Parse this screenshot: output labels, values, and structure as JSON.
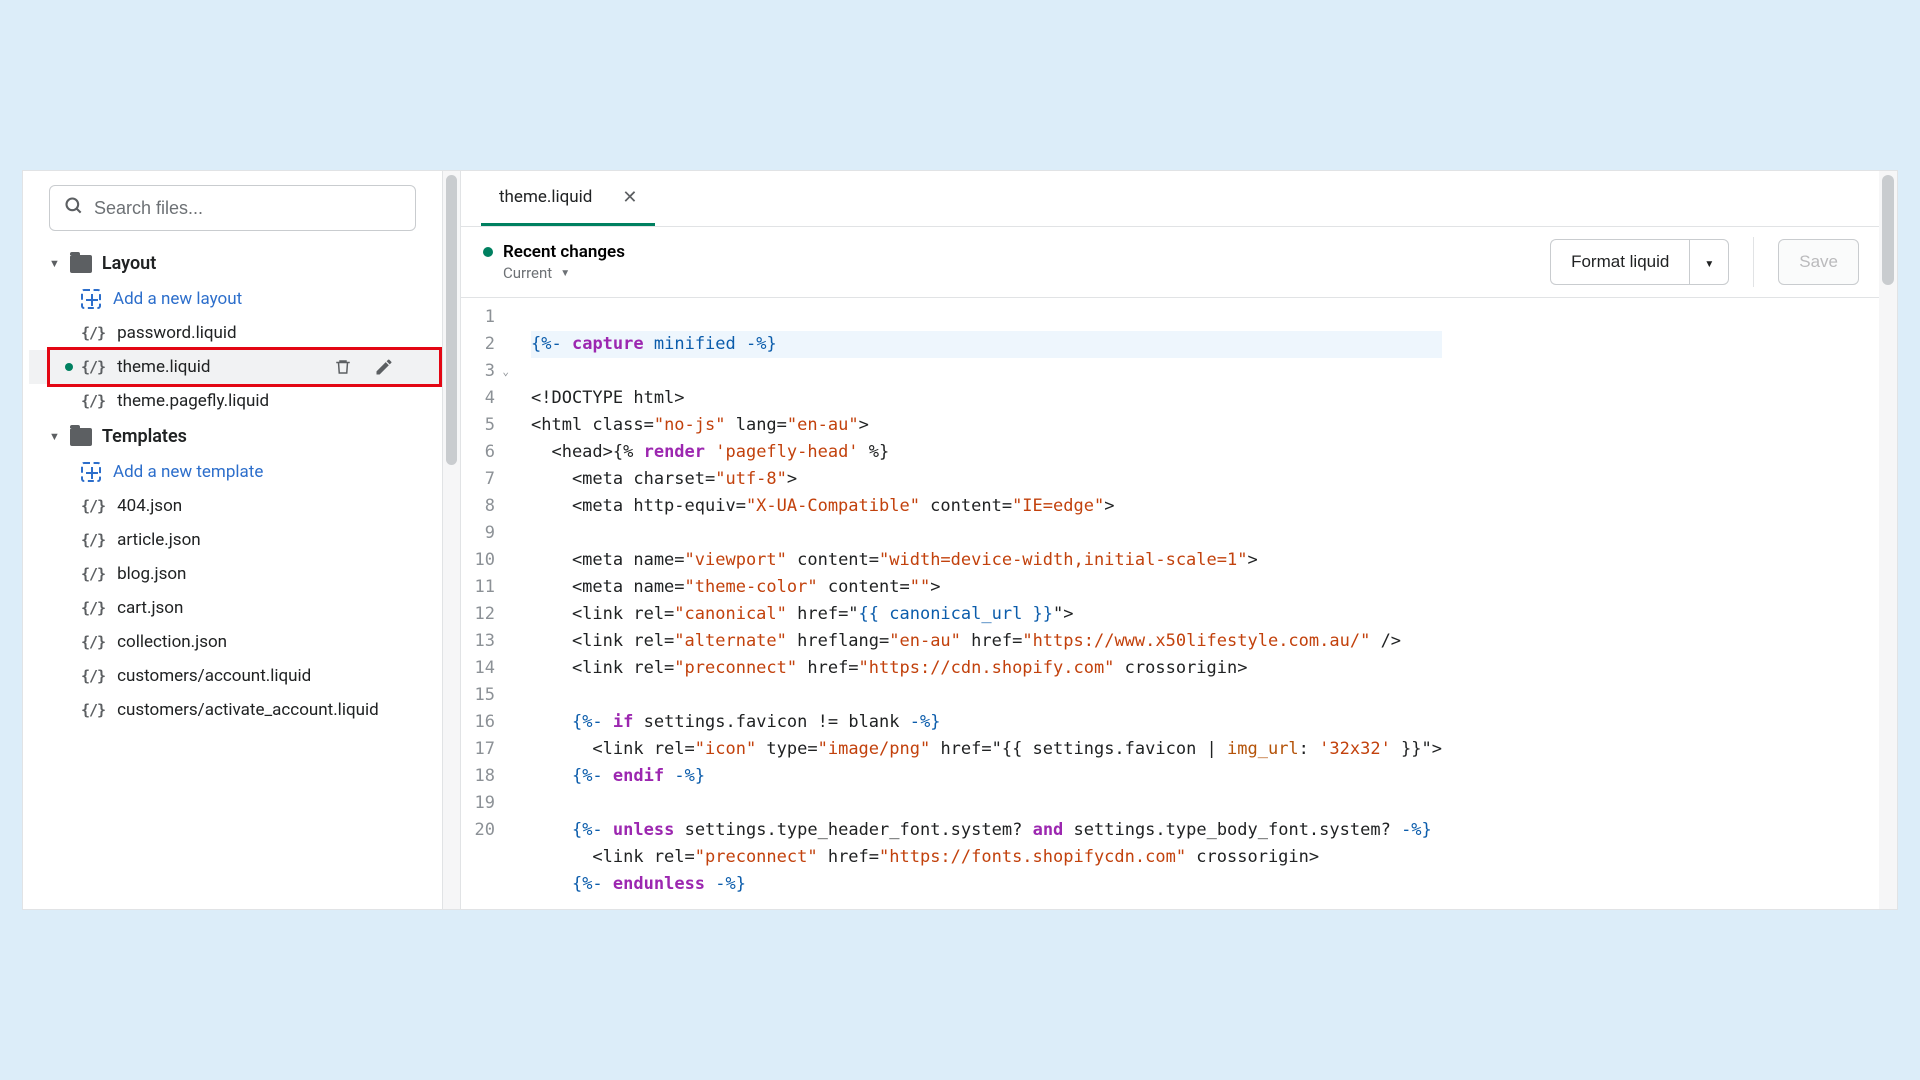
{
  "sidebar": {
    "search_placeholder": "Search files...",
    "sections": [
      {
        "name": "Layout",
        "add_label": "Add a new layout",
        "files": [
          {
            "name": "password.liquid",
            "type": "liquid"
          },
          {
            "name": "theme.liquid",
            "type": "liquid",
            "selected": true,
            "modified": true
          },
          {
            "name": "theme.pagefly.liquid",
            "type": "liquid"
          }
        ]
      },
      {
        "name": "Templates",
        "add_label": "Add a new template",
        "files": [
          {
            "name": "404.json",
            "type": "json"
          },
          {
            "name": "article.json",
            "type": "json"
          },
          {
            "name": "blog.json",
            "type": "json"
          },
          {
            "name": "cart.json",
            "type": "json"
          },
          {
            "name": "collection.json",
            "type": "json"
          },
          {
            "name": "customers/account.liquid",
            "type": "liquid"
          },
          {
            "name": "customers/activate_account.liquid",
            "type": "liquid"
          }
        ]
      }
    ]
  },
  "editor": {
    "tab_name": "theme.liquid",
    "recent_label": "Recent changes",
    "version_label": "Current",
    "format_label": "Format liquid",
    "save_label": "Save",
    "code": {
      "line1": "{%- capture minified -%}",
      "line2": "<!DOCTYPE html>",
      "line3_open": "<html ",
      "line3_class_attr": "class=",
      "line3_class_val": "\"no-js\"",
      "line3_lang_attr": " lang=",
      "line3_lang_val": "\"en-au\"",
      "line3_close": ">",
      "line4_pre": "  <head>{% ",
      "line4_render": "render",
      "line4_str": " 'pagefly-head'",
      "line4_post": " %}",
      "line5": "    <meta charset=\"utf-8\">",
      "line6": "    <meta http-equiv=\"X-UA-Compatible\" content=\"IE=edge\">",
      "line8": "    <meta name=\"viewport\" content=\"width=device-width,initial-scale=1\">",
      "line9": "    <meta name=\"theme-color\" content=\"\">",
      "line10_a": "    <link rel=\"canonical\" href=\"",
      "line10_var": "{{ canonical_url }}",
      "line10_b": "\">",
      "line11": "    <link rel=\"alternate\" hreflang=\"en-au\" href=\"https://www.x50lifestyle.com.au/\" />",
      "line12": "    <link rel=\"preconnect\" href=\"https://cdn.shopify.com\" crossorigin>",
      "line14": "    {%- if settings.favicon != blank -%}",
      "line15_a": "      <link rel=",
      "line15_icon": "\"icon\"",
      "line15_b": " type=",
      "line15_png": "\"image/png\"",
      "line15_c": " href=\"{{ settings.favicon | ",
      "line15_filter": "img_url:",
      "line15_d": " '32x32' }}\">",
      "line16": "    {%- endif -%}",
      "line18": "    {%- unless settings.type_header_font.system? and settings.type_body_font.system? -%}",
      "line19_a": "      <link rel=",
      "line19_pre": "\"preconnect\"",
      "line19_b": " href=",
      "line19_url": "\"https://fonts.shopifycdn.com\"",
      "line19_c": " crossorigin>",
      "line20": "    {%- endunless -%}"
    }
  }
}
